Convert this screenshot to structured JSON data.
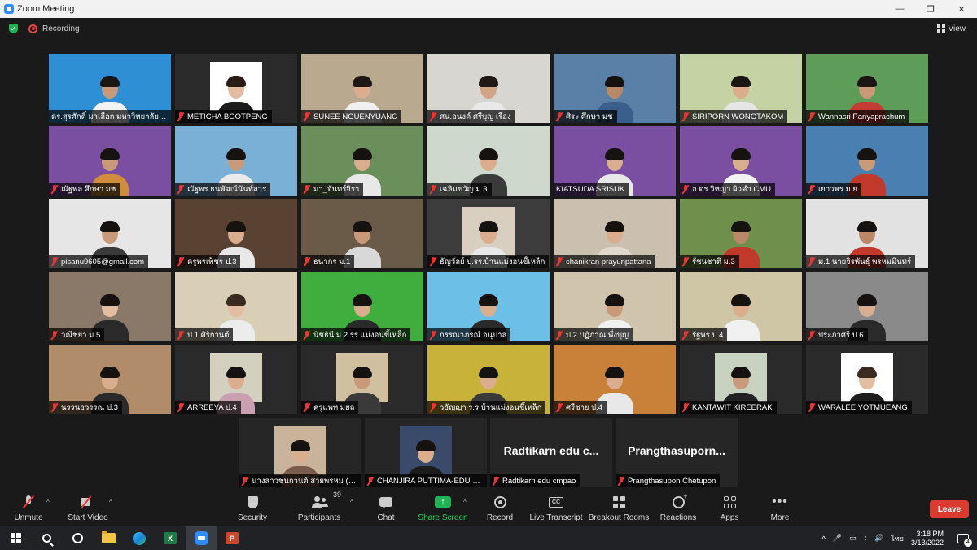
{
  "window": {
    "title": "Zoom Meeting",
    "controls": [
      "—",
      "❐",
      "✕"
    ]
  },
  "topbar": {
    "recording_label": "Recording",
    "view_label": "View"
  },
  "tiles": [
    {
      "name": "ดร.สุรศักดิ์ มาเลือก มหาวิทยาลัยเชีย...",
      "muted": false,
      "active": true,
      "bg": "#2f8fd4",
      "skin": "#c99a7a",
      "hair": "#1a1614",
      "shirt": "#f2f2f2"
    },
    {
      "name": "METICHA BOOTPENG",
      "muted": true,
      "bg": "#2a2a2a",
      "photo": "#ffffff",
      "skin": "#e3bda2",
      "hair": "#2a1d16",
      "shirt": "#1c1c1c"
    },
    {
      "name": "SUNEE NGUENYUANG",
      "muted": true,
      "bg": "#b9a98f",
      "skin": "#d9ad8e",
      "hair": "#1f1815",
      "shirt": "#f0f0f0"
    },
    {
      "name": "ศน.อนงค์ ศรีบุญ เรือง",
      "muted": true,
      "bg": "#d8d6d0",
      "skin": "#cfa487",
      "hair": "#1f1815",
      "shirt": "#e9e9e9"
    },
    {
      "name": "ศิระ ศึกษา มช",
      "muted": true,
      "bg": "#5b80a8",
      "skin": "#b98866",
      "hair": "#151210",
      "shirt": "#3a5f8c"
    },
    {
      "name": "SIRIPORN WONGTAKOM",
      "muted": true,
      "bg": "#c4d2a4",
      "skin": "#d9ad8e",
      "hair": "#1b1513",
      "shirt": "#e6e6e6"
    },
    {
      "name": "Wannasri Panyaprachum",
      "muted": true,
      "bg": "#5e9c59",
      "skin": "#c99a7a",
      "hair": "#1b1513",
      "shirt": "#c23d36"
    },
    {
      "name": "ณัฐพล ศึกษา มช",
      "muted": true,
      "bg": "#7a4ea0",
      "skin": "#c99a7a",
      "hair": "#151210",
      "shirt": "#d18c3c"
    },
    {
      "name": "ณัฐพร ธนพัฒน์นันท์สาร",
      "muted": true,
      "bg": "#7ab0d6",
      "skin": "#c99a7a",
      "hair": "#151210",
      "shirt": "#eaeaea"
    },
    {
      "name": "มา_จันทร์จิรา",
      "muted": true,
      "bg": "#6a8f5a",
      "skin": "#d9ad8e",
      "hair": "#151210",
      "shirt": "#e8e8e8"
    },
    {
      "name": "เฉลิมขวัญ ม.3",
      "muted": true,
      "bg": "#cfd8cc",
      "skin": "#d9ad8e",
      "hair": "#151210",
      "shirt": "#3a3a3a"
    },
    {
      "name": "KIATSUDA SRISUK",
      "muted": false,
      "bg": "#7a4ea0",
      "skin": "#d9ad8e",
      "hair": "#151210",
      "shirt": "#e8e8e8"
    },
    {
      "name": "อ.ดร.วิชญา ผิวคำ CMU",
      "muted": true,
      "bg": "#7a4ea0",
      "skin": "#d9ad8e",
      "hair": "#151210",
      "shirt": "#f2f2f2"
    },
    {
      "name": "เยาวพร ม.ย",
      "muted": true,
      "bg": "#4a7fb2",
      "skin": "#c99a7a",
      "hair": "#151210",
      "shirt": "#c0392b"
    },
    {
      "name": "pisanu9605@gmail.com",
      "muted": true,
      "bg": "#e6e6e6",
      "skin": "#c99a7a",
      "hair": "#151210",
      "shirt": "#3a3a3a"
    },
    {
      "name": "ครูพรเพ็ชร ป.3",
      "muted": true,
      "bg": "#5a4232",
      "skin": "#d9ad8e",
      "hair": "#151210",
      "shirt": "#e8e8e8"
    },
    {
      "name": "ธนากร ม.1",
      "muted": true,
      "bg": "#6a5a48",
      "skin": "#c99a7a",
      "hair": "#151210",
      "shirt": "#d8d8d8"
    },
    {
      "name": "ธัญวัลย์ ป.รร.บ้านแม่งอนขี้เหล็ก",
      "muted": true,
      "bg": "#3c3c3c",
      "photo": "#d8cfc0",
      "skin": "#d9ad8e",
      "hair": "#151210",
      "shirt": "#e8e8e8"
    },
    {
      "name": "chanikran prayunpattana",
      "muted": true,
      "bg": "#cbbfb0",
      "skin": "#d9ad8e",
      "hair": "#151210",
      "shirt": "#e0d8cc"
    },
    {
      "name": "รัชนชาติ ม.3",
      "muted": true,
      "bg": "#6f8f4d",
      "skin": "#b98866",
      "hair": "#151210",
      "shirt": "#c0392b"
    },
    {
      "name": "ม.1 นายจิรพันธุ์ พรหมมินทร์",
      "muted": true,
      "bg": "#e2e2e2",
      "skin": "#b98866",
      "hair": "#151210",
      "shirt": "#c0392b"
    },
    {
      "name": "วณีชยา ม.5",
      "muted": true,
      "bg": "#8a7868",
      "skin": "#e3bda2",
      "hair": "#151210",
      "shirt": "#2a2a2a"
    },
    {
      "name": "ป.1 ศิริกานต์",
      "muted": true,
      "bg": "#d9cfb6",
      "skin": "#e3bda2",
      "hair": "#3a2a20",
      "shirt": "#ececec"
    },
    {
      "name": "นิชธินี ม.2  รร.แม่งอนขี้เหล็ก",
      "muted": true,
      "bg": "#3fae3f",
      "skin": "#d9ad8e",
      "hair": "#151210",
      "shirt": "#2a2a2a"
    },
    {
      "name": "กรรณาภรณ์ อนุบาล",
      "muted": true,
      "bg": "#6cc0e8",
      "skin": "#d9ad8e",
      "hair": "#151210",
      "shirt": "#2a2a2a"
    },
    {
      "name": "ป.2 ปฏิภาณ พึ่งบุญ",
      "muted": true,
      "bg": "#d0c4ac",
      "skin": "#c99a7a",
      "hair": "#151210",
      "shirt": "#f0f0f0"
    },
    {
      "name": "รัฐพร ป.4",
      "muted": true,
      "bg": "#cfc6a6",
      "skin": "#d9ad8e",
      "hair": "#151210",
      "shirt": "#f0f0f0"
    },
    {
      "name": "ประภาศรี ป.6",
      "muted": true,
      "bg": "#8a8a8a",
      "skin": "#d9ad8e",
      "hair": "#151210",
      "shirt": "#2a2a2a"
    },
    {
      "name": "นรรนธวรรณ ป.3",
      "muted": true,
      "bg": "#b08c6a",
      "skin": "#d9ad8e",
      "hair": "#151210",
      "shirt": "#2a2a2a"
    },
    {
      "name": "ARREEYA ป.4",
      "muted": true,
      "bg": "#2a2a2a",
      "photo": "#d4d0c0",
      "skin": "#d9ad8e",
      "hair": "#151210",
      "shirt": "#c9a0b0"
    },
    {
      "name": "ครูแพท มยล",
      "muted": true,
      "bg": "#2a2a2a",
      "photo": "#d0c0a0",
      "skin": "#c99a7a",
      "hair": "#151210",
      "shirt": "#3a3a3a"
    },
    {
      "name": "วธัญญา ร.ร.บ้านแม่งอนขี้เหล็ก",
      "muted": true,
      "bg": "#c9b23a",
      "skin": "#d9ad8e",
      "hair": "#151210",
      "shirt": "#3a3a3a"
    },
    {
      "name": "ศรีชาย ป.4",
      "muted": true,
      "bg": "#c9813a",
      "skin": "#d9ad8e",
      "hair": "#151210",
      "shirt": "#e8e8e8"
    },
    {
      "name": "KANTAWIT KIREERAK",
      "muted": true,
      "bg": "#2a2a2a",
      "photo": "#c7d2c0",
      "skin": "#c99a7a",
      "hair": "#151210",
      "shirt": "#222222"
    },
    {
      "name": "WARALEE YOTMUEANG",
      "muted": true,
      "bg": "#2a2a2a",
      "photo": "#ffffff",
      "skin": "#e3bda2",
      "hair": "#3a2a20",
      "shirt": "#1c1c1c"
    }
  ],
  "bottom_tiles": [
    {
      "name": "นางสาวชนกานต์ สายพรหม (ม.2)",
      "muted": true,
      "bg": "#262626",
      "photo": "#c9b39a",
      "skin": "#d9ad8e",
      "hair": "#151210",
      "shirt": "#7a5a4a"
    },
    {
      "name": "CHANJIRA PUTTIMA-EDU C...",
      "muted": true,
      "bg": "#262626",
      "photo": "#3a4a6a",
      "skin": "#d9ad8e",
      "hair": "#151210",
      "shirt": "#1c1c1c"
    },
    {
      "name": "Radtikarn edu cmpao",
      "muted": true,
      "bg": "#262626",
      "big_name": "Radtikarn edu c..."
    },
    {
      "name": "Prangthasupon Chetupon",
      "muted": true,
      "bg": "#262626",
      "big_name": "Prangthasuporn..."
    }
  ],
  "toolbar": {
    "unmute": "Unmute",
    "start_video": "Start Video",
    "security": "Security",
    "participants": "Participants",
    "participant_count": "39",
    "chat": "Chat",
    "share_screen": "Share Screen",
    "record": "Record",
    "live_transcript": "Live Transcript",
    "breakout_rooms": "Breakout Rooms",
    "reactions": "Reactions",
    "apps": "Apps",
    "more": "More",
    "leave": "Leave",
    "caret": "^"
  },
  "taskbar": {
    "time": "3:18 PM",
    "date": "3/13/2022",
    "lang": "ไทย",
    "notif_count": "4",
    "excel_letter": "X",
    "ppt_letter": "P",
    "cc_text": "CC",
    "shield_check": "✓",
    "tray_icons": [
      "^",
      "🎤",
      "▭",
      "⌇",
      "🔊"
    ]
  }
}
